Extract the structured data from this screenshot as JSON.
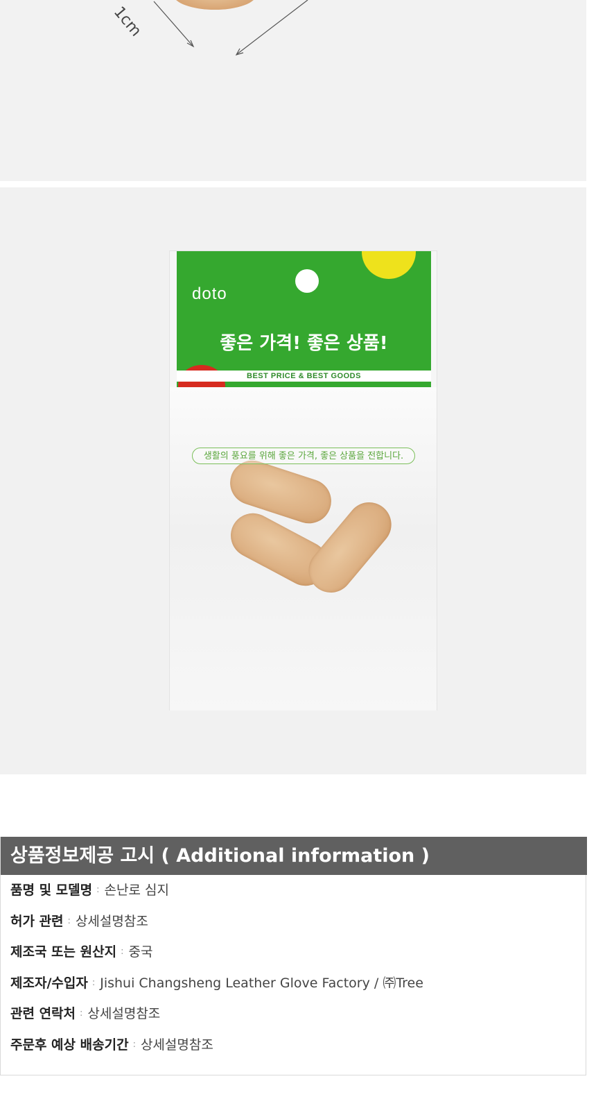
{
  "top_image": {
    "dimension_label": "1cm"
  },
  "product_image": {
    "brand": "doto",
    "slogan": "좋은 가격! 좋은 상품!",
    "tagline": "BEST PRICE & BEST GOODS",
    "bag_print": "생활의 풍요를 위해 좋은 가격, 좋은 상품을 전합니다."
  },
  "info": {
    "title": "상품정보제공 고시 ( Additional information )",
    "separator": ":",
    "rows": [
      {
        "key": "품명 및 모델명",
        "value": "손난로 심지"
      },
      {
        "key": "허가 관련",
        "value": "상세설명참조"
      },
      {
        "key": "제조국 또는 원산지",
        "value": "중국"
      },
      {
        "key": "제조자/수입자",
        "value": "Jishui Changsheng Leather Glove Factory / ㈜Tree"
      },
      {
        "key": "관련 연락처",
        "value": "상세설명참조"
      },
      {
        "key": "주문후 예상 배송기간",
        "value": "상세설명참조"
      }
    ]
  }
}
